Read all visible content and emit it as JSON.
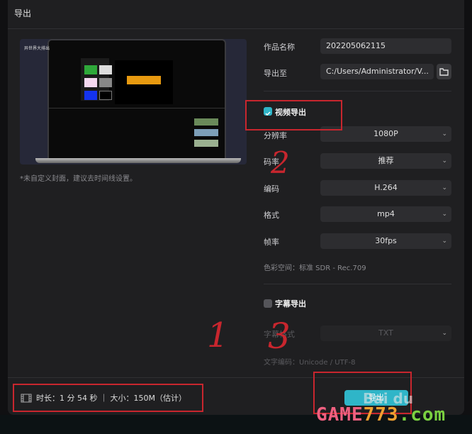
{
  "dialog": {
    "title": "导出"
  },
  "preview": {
    "caption": "*未自定义封面，建议去时间线设置。",
    "screen_text": "异世界大排出"
  },
  "form": {
    "name_label": "作品名称",
    "name_value": "202205062115",
    "path_label": "导出至",
    "path_value": "C:/Users/Administrator/V...",
    "video_export": {
      "label": "视频导出",
      "checked": true
    },
    "resolution": {
      "label": "分辨率",
      "value": "1080P"
    },
    "bitrate": {
      "label": "码率",
      "value": "推荐"
    },
    "codec": {
      "label": "编码",
      "value": "H.264"
    },
    "format": {
      "label": "格式",
      "value": "mp4"
    },
    "framerate": {
      "label": "帧率",
      "value": "30fps"
    },
    "color_space": "色彩空间：标准 SDR - Rec.709",
    "subtitle_export": {
      "label": "字幕导出",
      "checked": false
    },
    "subtitle_format": {
      "label": "字幕格式",
      "value": "TXT"
    },
    "text_encoding": "文字编码：Unicode / UTF-8"
  },
  "footer": {
    "info": "时长：1 分 54 秒 ｜ 大小：150M（估计）",
    "export_label": "导出"
  },
  "annotations": [
    "2",
    "3",
    "1"
  ],
  "watermark": {
    "game": "GAME773.com",
    "baidu": "Bai du"
  },
  "colors": {
    "accent": "#2fb5c8",
    "annotation": "#c8262e"
  }
}
